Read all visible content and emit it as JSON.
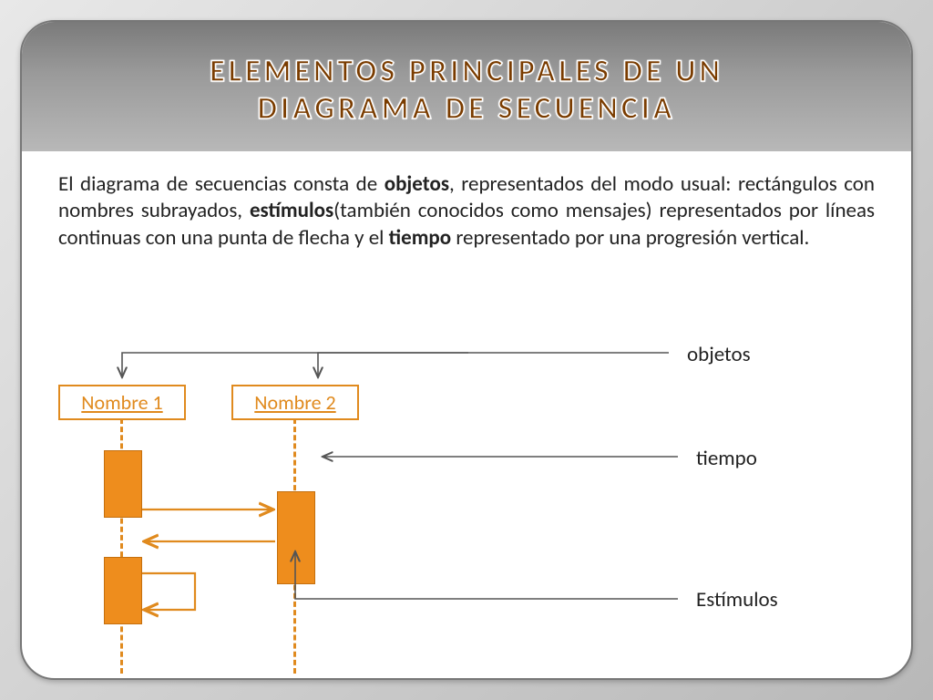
{
  "title_line1": "ELEMENTOS PRINCIPALES DE UN",
  "title_line2": "DIAGRAMA DE SECUENCIA",
  "paragraph": {
    "p1": "El diagrama de secuencias consta de ",
    "b1": "objetos",
    "p2": ", representados del modo usual: rectángulos con nombres subrayados, ",
    "b2": "estímulos",
    "p3": "(también conocidos como mensajes) representados por líneas continuas con una punta de flecha y el ",
    "b3": "tiempo",
    "p4": " representado por una progresión vertical."
  },
  "diagram": {
    "object1": "Nombre 1",
    "object2": "Nombre 2",
    "label_objects": "objetos",
    "label_time": "tiempo",
    "label_stimuli": "Estímulos"
  }
}
